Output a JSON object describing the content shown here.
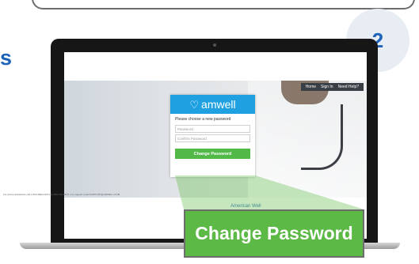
{
  "step": {
    "number": "2"
  },
  "side_partial": "s",
  "site": {
    "nav": [
      "Home",
      "Sign In",
      "Need Help?"
    ],
    "logo": "amwell",
    "prompt": "Please choose a new password",
    "password_placeholder": "Password",
    "confirm_placeholder": "Confirm Password",
    "button_label": "Change Password",
    "footer_text": "For phone assistance call 1-844-SEE-DOCS (1-844-733-3627). For support email SUPPORT@AMWELL.COM",
    "footer_logo": "American Well"
  },
  "callout": {
    "label": "Change Password"
  },
  "colors": {
    "accent": "#1e63b8",
    "button": "#5cb946",
    "brand": "#1fa0e0"
  }
}
